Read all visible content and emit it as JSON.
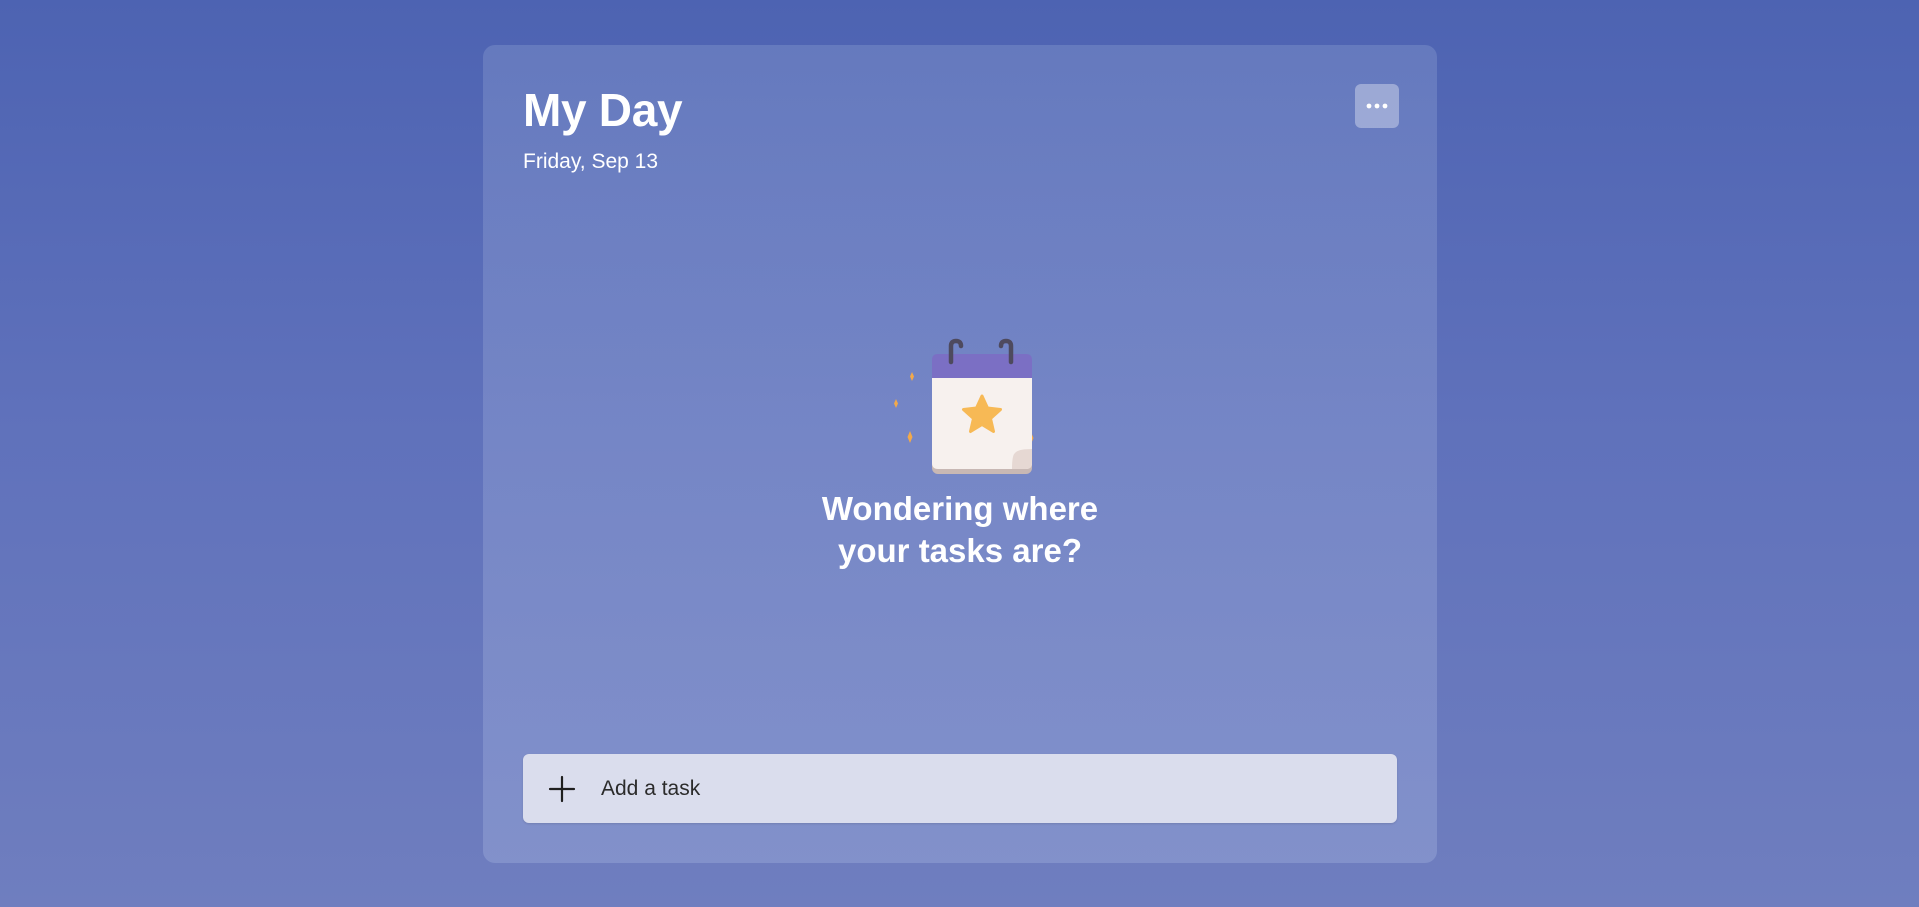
{
  "header": {
    "title": "My Day",
    "date": "Friday, Sep 13",
    "more_button_icon": "more-horizontal-icon"
  },
  "empty_state": {
    "illustration_icon": "calendar-star-icon",
    "line1": "Wondering where",
    "line2": "your tasks are?"
  },
  "add_task": {
    "icon": "plus-icon",
    "placeholder": "Add a task",
    "value": ""
  },
  "colors": {
    "background_top": "#4d63b2",
    "background_bottom": "#6f7ebf",
    "add_task_bg": "#dadded",
    "calendar_header": "#7b6fc4",
    "star": "#f7b955"
  }
}
